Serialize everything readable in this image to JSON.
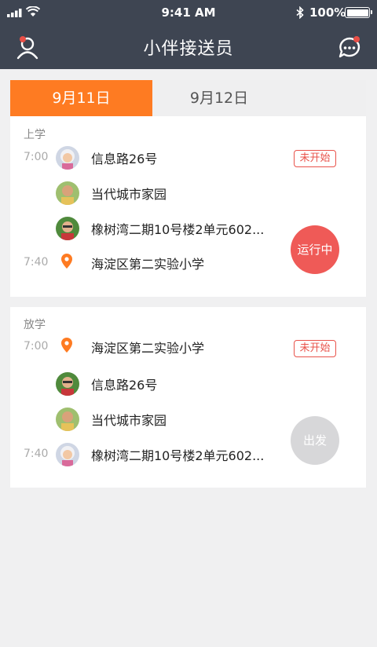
{
  "status_bar": {
    "time": "9:41 AM",
    "battery": "100%"
  },
  "nav": {
    "title": "小伴接送员",
    "profile_icon": "person-icon",
    "message_icon": "chat-bubble-icon",
    "accent": "#3e4552"
  },
  "tabs": [
    {
      "label": "9月11日",
      "active": true
    },
    {
      "label": "9月12日",
      "active": false
    }
  ],
  "morning": {
    "label": "上学",
    "status": "未开始",
    "action": "运行中",
    "stops": [
      {
        "time": "7:00",
        "address": "信息路26号",
        "kind": "child"
      },
      {
        "time": "",
        "address": "当代城市家园",
        "kind": "child"
      },
      {
        "time": "",
        "address": "橡树湾二期10号楼2单元602...",
        "kind": "child"
      },
      {
        "time": "7:40",
        "address": "海淀区第二实验小学",
        "kind": "school"
      }
    ]
  },
  "afternoon": {
    "label": "放学",
    "status": "未开始",
    "action": "出发",
    "stops": [
      {
        "time": "7:00",
        "address": "海淀区第二实验小学",
        "kind": "school"
      },
      {
        "time": "",
        "address": "信息路26号",
        "kind": "child"
      },
      {
        "time": "",
        "address": "当代城市家园",
        "kind": "child"
      },
      {
        "time": "7:40",
        "address": "橡树湾二期10号楼2单元602...",
        "kind": "child"
      }
    ]
  },
  "colors": {
    "orange": "#fe7b22",
    "red": "#e9534b",
    "gray_button": "#d7d7d9"
  }
}
